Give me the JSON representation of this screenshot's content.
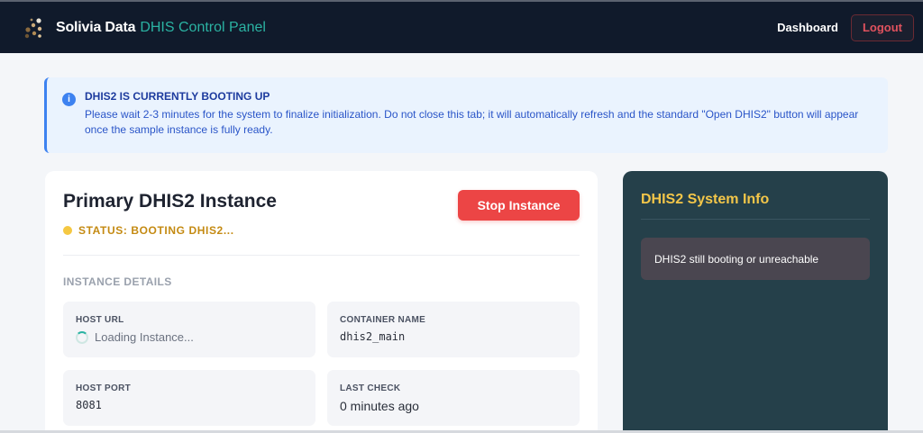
{
  "navbar": {
    "logo_icon": "molecule-logo-icon",
    "brand_name": "Solivia Data",
    "brand_sub": "DHIS Control Panel",
    "dashboard_label": "Dashboard",
    "logout_label": "Logout"
  },
  "alert": {
    "icon": "info-icon",
    "icon_glyph": "i",
    "title": "DHIS2 IS CURRENTLY BOOTING UP",
    "message": "Please wait 2-3 minutes for the system to finalize initialization. Do not close this tab; it will automatically refresh and the standard \"Open DHIS2\" button will appear once the sample instance is fully ready."
  },
  "instance": {
    "title": "Primary DHIS2 Instance",
    "status_text": "STATUS: BOOTING DHIS2...",
    "status_color": "#f5c842",
    "stop_button_label": "Stop Instance",
    "section_title": "INSTANCE DETAILS",
    "details": {
      "host_url_label": "HOST URL",
      "host_url_value": "Loading Instance...",
      "container_name_label": "CONTAINER NAME",
      "container_name_value": "dhis2_main",
      "host_port_label": "HOST PORT",
      "host_port_value": "8081",
      "last_check_label": "LAST CHECK",
      "last_check_value": "0 minutes ago"
    }
  },
  "system_info": {
    "title": "DHIS2 System Info",
    "message": "DHIS2 still booting or unreachable"
  },
  "colors": {
    "navbar_bg": "#101a2b",
    "accent_teal": "#2bb3a3",
    "danger": "#ec4545",
    "info_blue": "#3d82f0",
    "panel_bg": "#25404a",
    "panel_title": "#f3c649"
  }
}
